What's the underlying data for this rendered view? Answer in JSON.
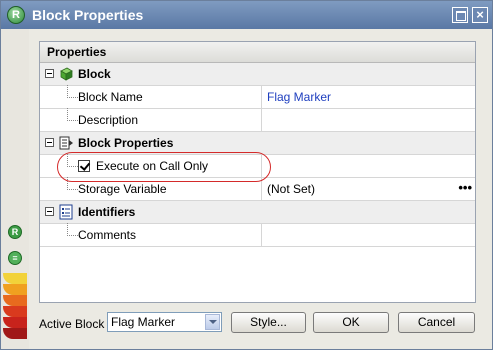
{
  "window": {
    "title": "Block Properties",
    "app_icon_letter": "R"
  },
  "panel": {
    "header": "Properties",
    "categories": [
      {
        "label": "Block",
        "icon": "green-cube-icon"
      },
      {
        "label": "Block Properties",
        "icon": "properties-list-icon"
      },
      {
        "label": "Identifiers",
        "icon": "identifiers-list-icon"
      }
    ],
    "rows": {
      "block_name": {
        "name": "Block Name",
        "value": "Flag Marker"
      },
      "description": {
        "name": "Description",
        "value": ""
      },
      "execute_on_call_only": {
        "label": "Execute on Call Only",
        "checked": true
      },
      "storage_variable": {
        "name": "Storage Variable",
        "value": "(Not Set)",
        "ellipsis": "•••"
      },
      "comments": {
        "name": "Comments",
        "value": ""
      }
    },
    "highlight_color": "#d42a2a"
  },
  "footer": {
    "active_block_label": "Active Block",
    "active_block_value": "Flag Marker",
    "style_button": "Style...",
    "ok_button": "OK",
    "cancel_button": "Cancel"
  },
  "rail": {
    "icon_1_letter": "R",
    "icon_2_letter": "≡"
  },
  "colors": {
    "title_bar": "#5a78a5",
    "accent_green": "#3d9c45",
    "link_blue": "#1f3fbf"
  }
}
